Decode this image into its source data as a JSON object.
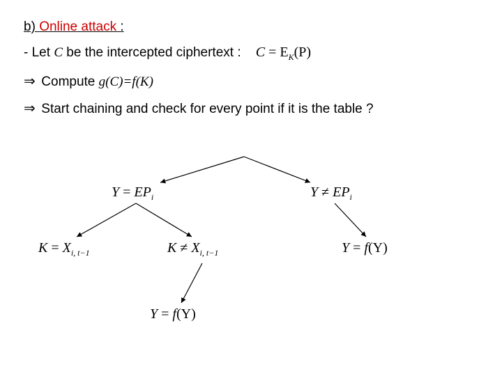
{
  "heading": {
    "prefix": "b) ",
    "highlight": "Online attack",
    "suffix": " :"
  },
  "line_let": {
    "before": "- Let ",
    "var": "C",
    "after": " be the intercepted ciphertext :"
  },
  "eq_top": {
    "lhs": "C",
    "mid": " = E",
    "sub": "K",
    "rhs": "(P)"
  },
  "line_compute": {
    "arrow": "⇒",
    "before": " Compute ",
    "expr": "g(C)=f(K)"
  },
  "line_start": {
    "arrow": "⇒",
    "text": " Start chaining and check for every point if it is the table ?"
  },
  "diagram": {
    "n1": {
      "lhs": "Y",
      "op": " = ",
      "rhs_a": "EP",
      "rhs_sub": "i"
    },
    "n2": {
      "lhs": "Y",
      "op": " ≠ ",
      "rhs_a": "EP",
      "rhs_sub": "i"
    },
    "n3": {
      "lhs": "K",
      "op": " = ",
      "rhs_a": "X",
      "rhs_sub": "i, t−1"
    },
    "n4": {
      "lhs": "K",
      "op": " ≠ ",
      "rhs_a": "X",
      "rhs_sub": "i, t−1"
    },
    "n5": {
      "lhs": "Y",
      "op": " = ",
      "rhs_fn": "f",
      "arg": "(Y)"
    },
    "n6": {
      "lhs": "Y",
      "op": " = ",
      "rhs_fn": "f",
      "arg": "(Y)"
    }
  }
}
